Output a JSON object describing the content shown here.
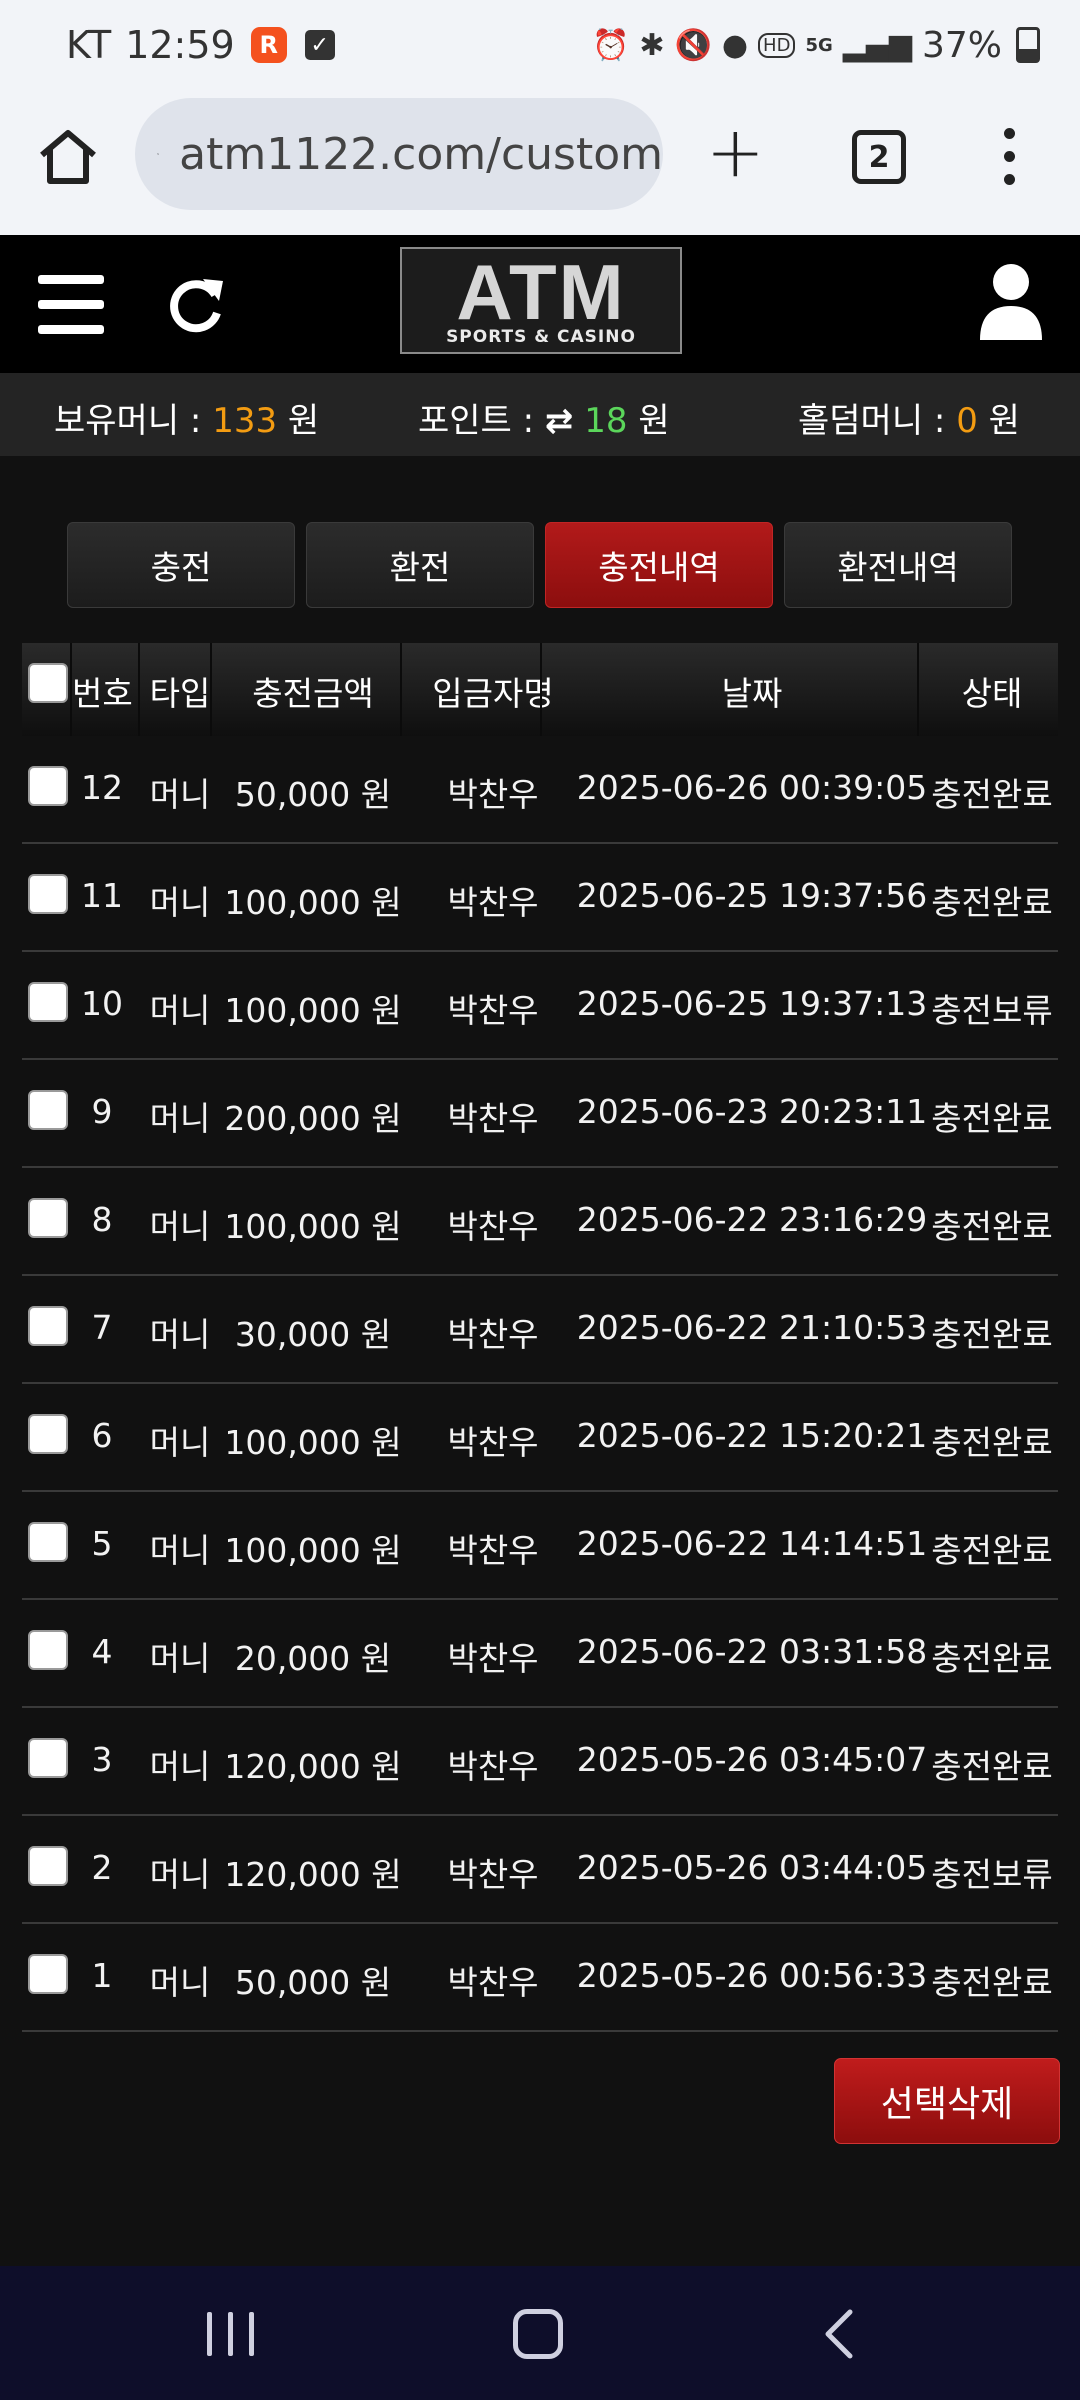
{
  "status_bar": {
    "carrier": "KT",
    "time": "12:59",
    "app_badge": "R",
    "battery": "37%",
    "hd_label": "HD",
    "network": "5G"
  },
  "browser": {
    "url": "atm1122.com/custom",
    "tab_count": "2"
  },
  "site": {
    "logo_text": "ATM",
    "logo_sub": "SPORTS & CASINO"
  },
  "money_bar": {
    "balance_label": "보유머니 :",
    "balance_value": "133",
    "points_label": "포인트 :",
    "points_swap_icon": "⇄",
    "points_value": "18",
    "holdem_label": "홀덤머니 :",
    "holdem_value": "0",
    "unit": "원"
  },
  "tabs": [
    {
      "label": "충전",
      "active": false
    },
    {
      "label": "환전",
      "active": false
    },
    {
      "label": "충전내역",
      "active": true
    },
    {
      "label": "환전내역",
      "active": false
    }
  ],
  "table": {
    "headers": {
      "number": "번호",
      "type": "타입",
      "amount": "충전금액",
      "depositor": "입금자명",
      "date": "날짜",
      "status": "상태"
    },
    "rows": [
      {
        "no": "12",
        "type": "머니",
        "amount": "50,000 원",
        "name": "박찬우",
        "date": "2025-06-26 00:39:05",
        "status": "충전완료"
      },
      {
        "no": "11",
        "type": "머니",
        "amount": "100,000 원",
        "name": "박찬우",
        "date": "2025-06-25 19:37:56",
        "status": "충전완료"
      },
      {
        "no": "10",
        "type": "머니",
        "amount": "100,000 원",
        "name": "박찬우",
        "date": "2025-06-25 19:37:13",
        "status": "충전보류"
      },
      {
        "no": "9",
        "type": "머니",
        "amount": "200,000 원",
        "name": "박찬우",
        "date": "2025-06-23 20:23:11",
        "status": "충전완료"
      },
      {
        "no": "8",
        "type": "머니",
        "amount": "100,000 원",
        "name": "박찬우",
        "date": "2025-06-22 23:16:29",
        "status": "충전완료"
      },
      {
        "no": "7",
        "type": "머니",
        "amount": "30,000 원",
        "name": "박찬우",
        "date": "2025-06-22 21:10:53",
        "status": "충전완료"
      },
      {
        "no": "6",
        "type": "머니",
        "amount": "100,000 원",
        "name": "박찬우",
        "date": "2025-06-22 15:20:21",
        "status": "충전완료"
      },
      {
        "no": "5",
        "type": "머니",
        "amount": "100,000 원",
        "name": "박찬우",
        "date": "2025-06-22 14:14:51",
        "status": "충전완료"
      },
      {
        "no": "4",
        "type": "머니",
        "amount": "20,000 원",
        "name": "박찬우",
        "date": "2025-06-22 03:31:58",
        "status": "충전완료"
      },
      {
        "no": "3",
        "type": "머니",
        "amount": "120,000 원",
        "name": "박찬우",
        "date": "2025-05-26 03:45:07",
        "status": "충전완료"
      },
      {
        "no": "2",
        "type": "머니",
        "amount": "120,000 원",
        "name": "박찬우",
        "date": "2025-05-26 03:44:05",
        "status": "충전보류"
      },
      {
        "no": "1",
        "type": "머니",
        "amount": "50,000 원",
        "name": "박찬우",
        "date": "2025-05-26 00:56:33",
        "status": "충전완료"
      }
    ]
  },
  "actions": {
    "delete_selected": "선택삭제"
  },
  "colors": {
    "accent_red": "#b21a1a",
    "money_orange": "#f39c12",
    "points_green": "#5bd65b",
    "page_bg": "#111111"
  },
  "icons": {
    "home": "home-icon",
    "site_settings": "tune-icon",
    "new_tab": "plus-icon",
    "tab_switcher": "tabs-icon",
    "browser_menu": "more-vert-icon",
    "site_menu": "hamburger-icon",
    "refresh": "refresh-icon",
    "account": "user-icon"
  }
}
